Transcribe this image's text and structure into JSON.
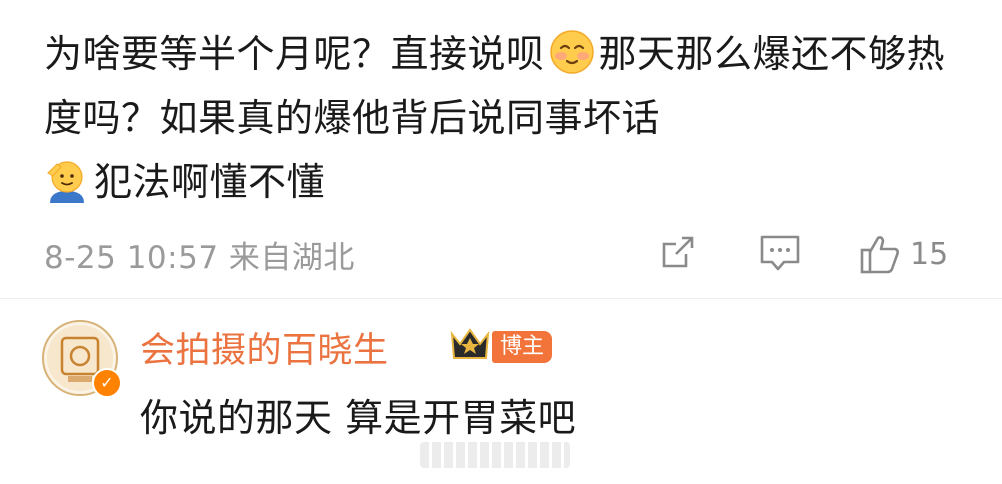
{
  "comment": {
    "text_part1": "为啥要等半个月呢？直接说呗",
    "emoji1": "flushed-smile-emoji",
    "text_part2": "那天那么爆还不够热度吗？如果真的爆他背后说同事坏话",
    "emoji2": "salute-emoji",
    "text_part3": "犯法啊懂不懂",
    "meta": "8-25 10:57 来自湖北",
    "like_count": "15"
  },
  "reply": {
    "username": "会拍摄的百晓生",
    "badge": "博主",
    "text": "你说的那天 算是开胃菜吧",
    "verified": true
  },
  "colors": {
    "username": "#eb7340",
    "badge_bg": "#f2743a",
    "meta_gray": "#9a9a9a",
    "verified_orange": "#ff8200"
  }
}
